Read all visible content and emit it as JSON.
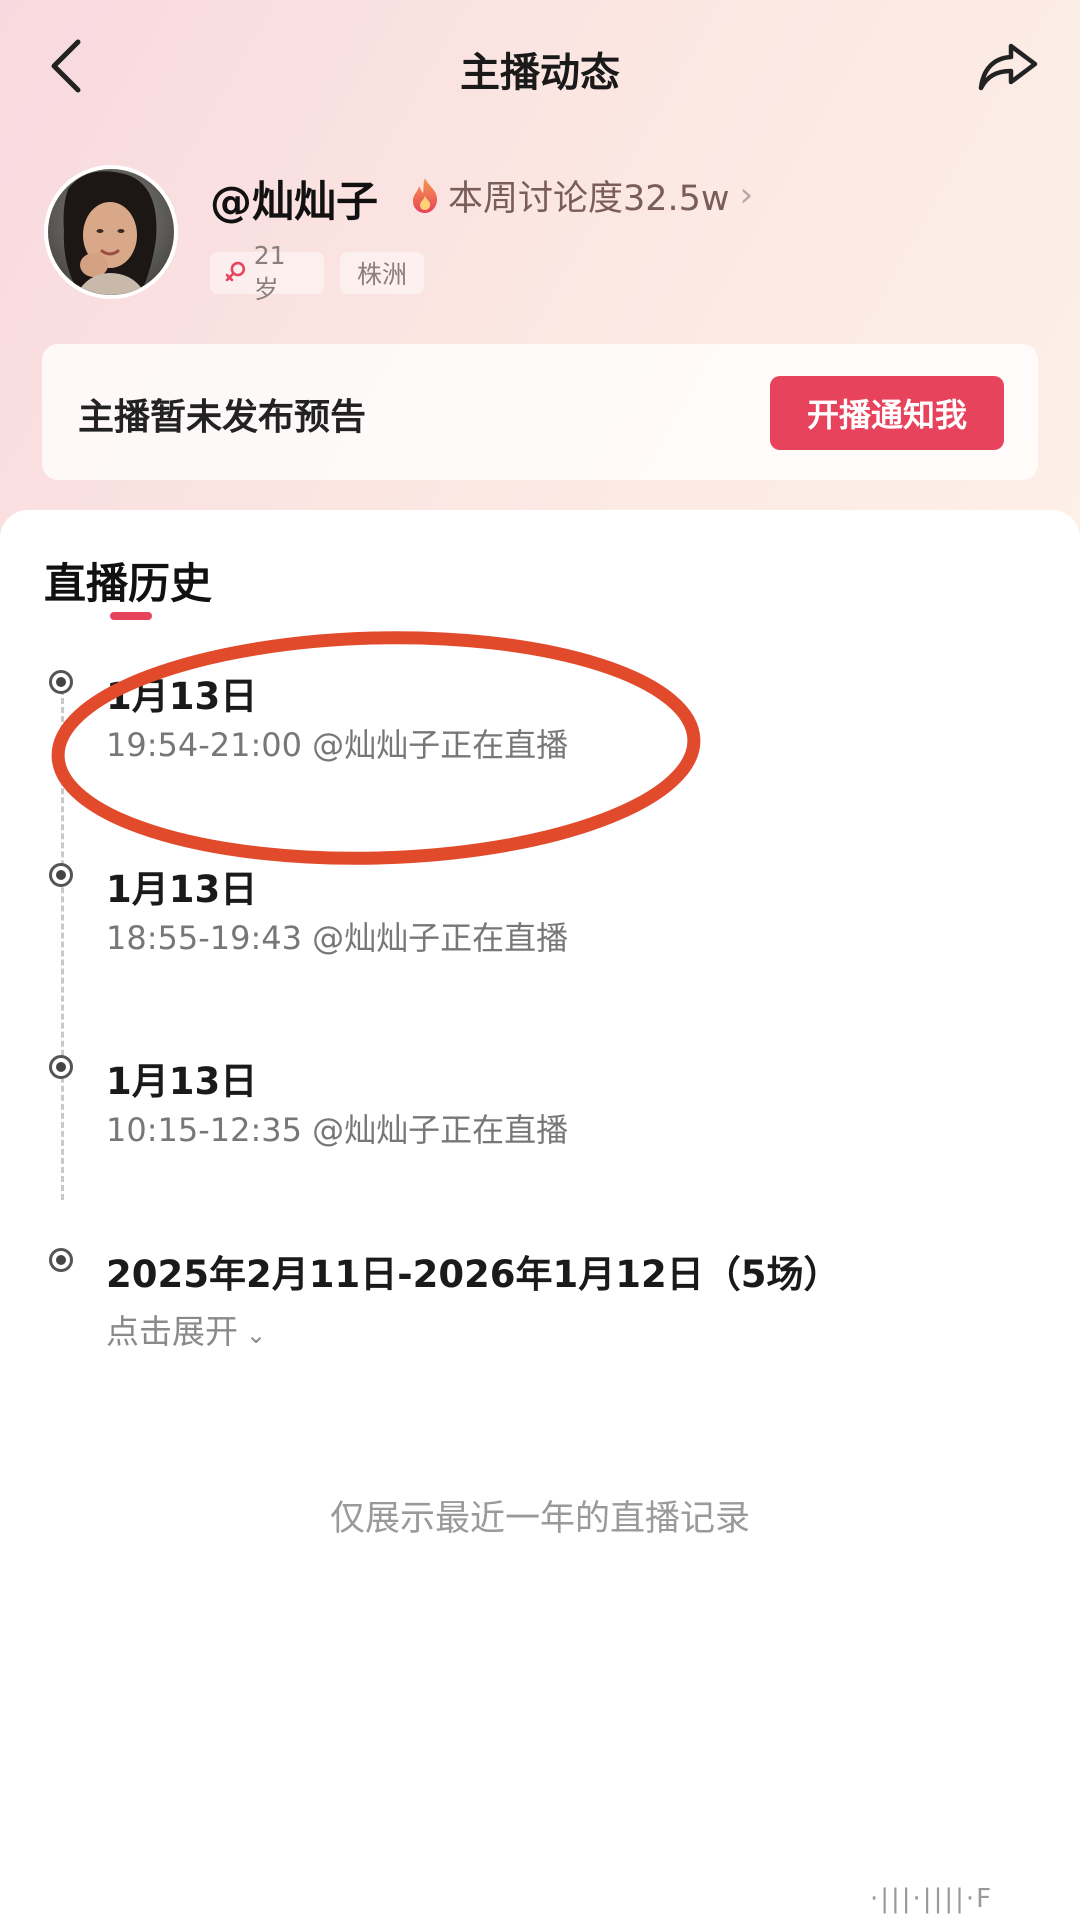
{
  "nav": {
    "title": "主播动态"
  },
  "profile": {
    "username": "@灿灿子",
    "hot_text": "本周讨论度32.5w",
    "age": "21岁",
    "city": "株洲"
  },
  "notice": {
    "text": "主播暂未发布预告",
    "button": "开播通知我"
  },
  "history": {
    "title": "直播历史",
    "entries": [
      {
        "date": "1月13日",
        "detail": "19:54-21:00 @灿灿子正在直播"
      },
      {
        "date": "1月13日",
        "detail": "18:55-19:43 @灿灿子正在直播"
      },
      {
        "date": "1月13日",
        "detail": "10:15-12:35 @灿灿子正在直播"
      }
    ],
    "range": {
      "label": "2025年2月11日-2026年1月12日（5场）",
      "expand": "点击展开"
    },
    "footer": "仅展示最近一年的直播记录"
  },
  "colors": {
    "accent": "#e8435c",
    "annotation": "#e24a2c"
  }
}
